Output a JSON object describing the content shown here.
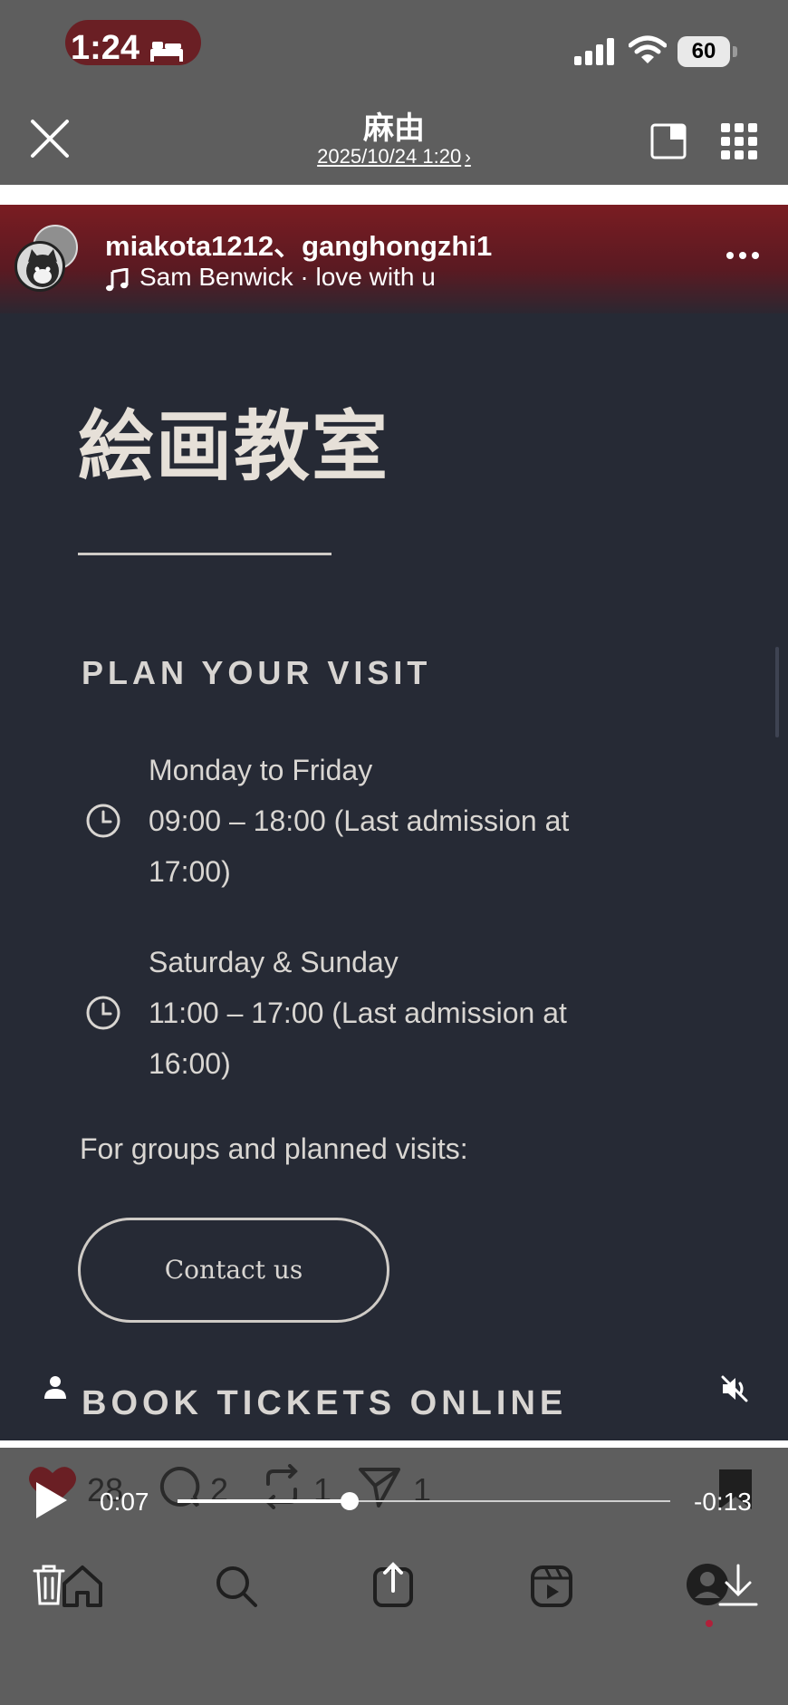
{
  "status_bar": {
    "time": "1:24",
    "battery": "60",
    "icons": [
      "bed-icon",
      "signal-icon",
      "wifi-icon",
      "battery-icon"
    ]
  },
  "header": {
    "title": "麻由",
    "date": "2025/10/24 1:20",
    "icons": [
      "close-icon",
      "split-view-icon",
      "grid-icon"
    ]
  },
  "post": {
    "usernames": "miakota1212、ganghongzhi1",
    "music": "Sam Benwick · love with u",
    "icons": [
      "music-note-icon",
      "more-icon",
      "person-icon",
      "mute-icon"
    ]
  },
  "video_content": {
    "heading": "絵画教室",
    "plan_title": "PLAN YOUR VISIT",
    "weekday": {
      "days": "Monday to Friday",
      "hours_line1": "09:00 – 18:00 (Last admission at",
      "hours_line2": "17:00)"
    },
    "weekend": {
      "days": "Saturday & Sunday",
      "hours_line1": "11:00 – 17:00 (Last admission at",
      "hours_line2": "16:00)"
    },
    "groups_text": "For groups and planned visits:",
    "contact_button": "Contact us",
    "book_title": "BOOK TICKETS ONLINE"
  },
  "player": {
    "elapsed": "0:07",
    "remaining": "-0:13",
    "progress": 0.35
  },
  "stats": {
    "likes": "28",
    "comments": "2",
    "reposts": "1",
    "sends": "1"
  },
  "bottom_nav": {
    "items": [
      "home-icon",
      "search-icon",
      "share-icon",
      "reels-icon",
      "profile-icon"
    ],
    "overlay_icons": [
      "trash-icon",
      "download-icon"
    ]
  },
  "colors": {
    "background": "#5e5e5e",
    "video_bg": "#262a35",
    "header_gradient": "#7a1c22",
    "accent_dot": "#b0203a",
    "text_light": "#d9d6d2"
  }
}
